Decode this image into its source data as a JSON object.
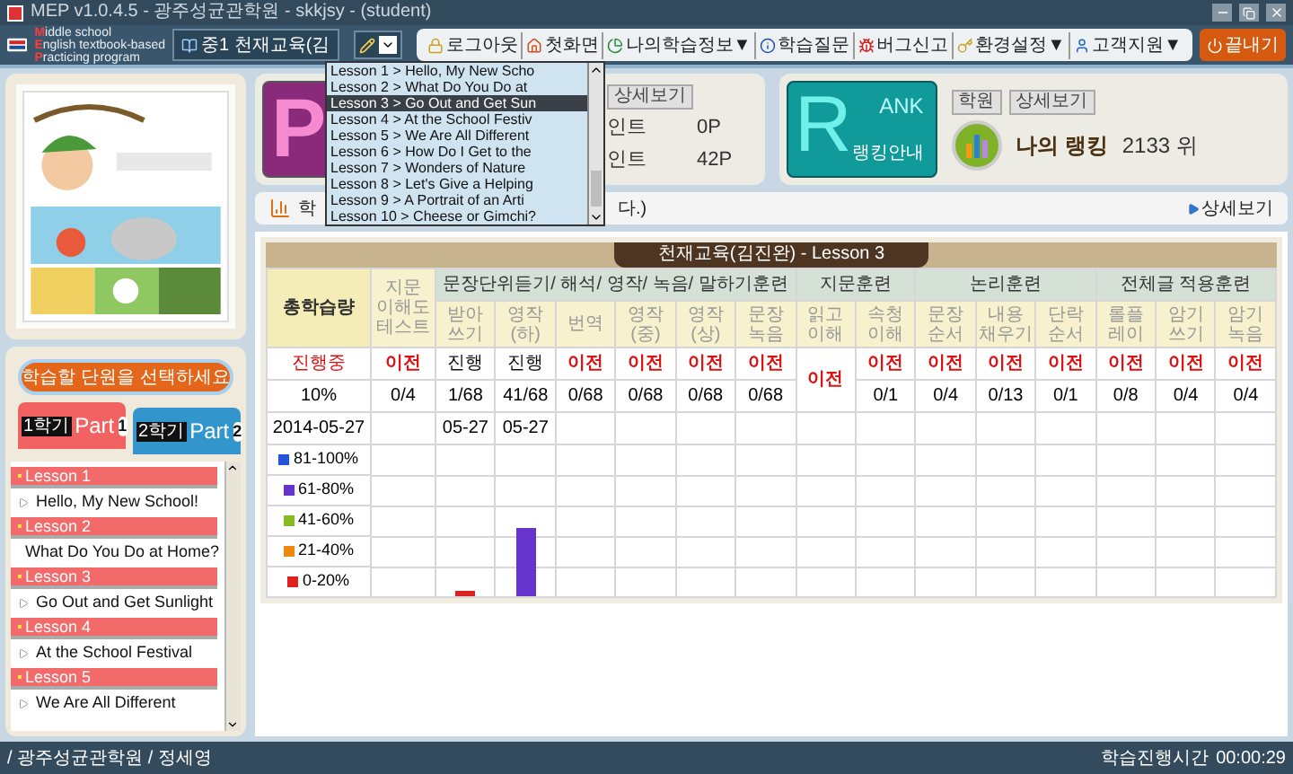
{
  "window": {
    "title": "MEP v1.0.4.5 - 광주성균관학원 - skkjsy - (student)"
  },
  "header": {
    "logo_lines": [
      {
        "initial": "M",
        "rest": "iddle school"
      },
      {
        "initial": "E",
        "rest": "nglish textbook-based"
      },
      {
        "initial": "P",
        "rest": "racticing program"
      }
    ],
    "course_tab": "중1 천재교육(김",
    "toolbar": [
      {
        "label": "로그아웃",
        "kind": "lock"
      },
      {
        "label": "첫화면",
        "kind": "home"
      },
      {
        "label": "나의학습정보▼",
        "kind": "chart"
      },
      {
        "label": "학습질문",
        "kind": "info"
      },
      {
        "label": "버그신고",
        "kind": "bug"
      },
      {
        "label": "환경설정▼",
        "kind": "key"
      },
      {
        "label": "고객지원▼",
        "kind": "person"
      }
    ],
    "exit_button": "끝내기"
  },
  "lesson_dropdown": {
    "expanded": true,
    "options": [
      {
        "label": "Lesson 1 > Hello, My New Scho",
        "selected": false
      },
      {
        "label": "Lesson 2 > What Do You Do at",
        "selected": false
      },
      {
        "label": "Lesson 3 > Go Out and Get Sun",
        "selected": true
      },
      {
        "label": "Lesson 4 > At the School Festiv",
        "selected": false
      },
      {
        "label": "Lesson 5 > We Are All Different",
        "selected": false
      },
      {
        "label": "Lesson 6 > How Do I Get to the",
        "selected": false
      },
      {
        "label": "Lesson 7 > Wonders of Nature",
        "selected": false
      },
      {
        "label": "Lesson 8 > Let's Give a Helping",
        "selected": false
      },
      {
        "label": "Lesson 9 > A Portrait of an Arti",
        "selected": false
      },
      {
        "label": "Lesson 10 > Cheese or Gimchi?",
        "selected": false
      }
    ]
  },
  "point_card": {
    "tile_letter": "P",
    "buttons": [
      "상세보기"
    ],
    "rows": [
      {
        "label": "인트",
        "value": "0P"
      },
      {
        "label": "인트",
        "value": "42P"
      }
    ]
  },
  "rank_card": {
    "tile_letter": "R",
    "tile_word": "ANK",
    "tile_caption": "랭킹안내",
    "buttons": [
      "학원",
      "상세보기"
    ],
    "label": "나의 랭킹",
    "value": "2133 위"
  },
  "study_bar": {
    "prefix": "학",
    "suffix": "다.)",
    "link": "상세보기"
  },
  "sidebar": {
    "select_button": "학습할 단원을 선택하세요",
    "part_tabs": [
      {
        "semester": "1학기",
        "label": "Part",
        "number": "1",
        "selected": true
      },
      {
        "semester": "2학기",
        "label": "Part",
        "number": "2",
        "selected": false
      }
    ],
    "lessons": [
      {
        "label": "Lesson 1",
        "title": "Hello, My New School!"
      },
      {
        "label": "Lesson 2",
        "title": "What Do You Do at Home?"
      },
      {
        "label": "Lesson 3",
        "title": "Go Out and Get Sunlight"
      },
      {
        "label": "Lesson 4",
        "title": "At the School Festival"
      },
      {
        "label": "Lesson 5",
        "title": "We Are All Different"
      }
    ]
  },
  "table": {
    "title": "천재교육(김진완) - Lesson 3",
    "summary": {
      "header": "총학습량",
      "status": "진행중",
      "count": "10%",
      "date": "2014-05-27"
    },
    "legend": [
      {
        "label": "81-100%",
        "color": "#2255dd"
      },
      {
        "label": "61-80%",
        "color": "#6633cc"
      },
      {
        "label": "41-60%",
        "color": "#88bb22"
      },
      {
        "label": "21-40%",
        "color": "#ee8811"
      },
      {
        "label": "0-20%",
        "color": "#dd2222"
      }
    ],
    "test_column": {
      "header": "지문\n이해도\n테스트",
      "status": "이전",
      "emphasized": true,
      "count": "0/4"
    },
    "groups": [
      {
        "title": "문장단위듣기/ 해석/ 영작/ 녹음/ 말하기훈련",
        "columns": [
          {
            "header": "받아\n쓰기",
            "status": "진행",
            "emphasized": false,
            "count": "1/68",
            "date": "05-27",
            "bar": {
              "level": 0.04,
              "color": "#dd2222"
            }
          },
          {
            "header": "영작\n(하)",
            "status": "진행",
            "emphasized": false,
            "count": "41/68",
            "date": "05-27",
            "bar": {
              "level": 0.45,
              "color": "#6633cc"
            }
          },
          {
            "header": "번역",
            "status": "이전",
            "emphasized": true,
            "count": "0/68"
          },
          {
            "header": "영작\n(중)",
            "status": "이전",
            "emphasized": true,
            "count": "0/68"
          },
          {
            "header": "영작\n(상)",
            "status": "이전",
            "emphasized": true,
            "count": "0/68"
          },
          {
            "header": "문장\n녹음",
            "status": "이전",
            "emphasized": true,
            "count": "0/68"
          }
        ]
      },
      {
        "title": "지문훈련",
        "columns": [
          {
            "header": "읽고\n이해",
            "status": "이전",
            "emphasized": true,
            "merged": true
          },
          {
            "header": "속청\n이해",
            "status": "이전",
            "emphasized": true,
            "count": "0/1"
          }
        ]
      },
      {
        "title": "논리훈련",
        "columns": [
          {
            "header": "문장\n순서",
            "status": "이전",
            "emphasized": true,
            "count": "0/4"
          },
          {
            "header": "내용\n채우기",
            "status": "이전",
            "emphasized": true,
            "count": "0/13"
          },
          {
            "header": "단락\n순서",
            "status": "이전",
            "emphasized": true,
            "count": "0/1"
          }
        ]
      },
      {
        "title": "전체글 적용훈련",
        "columns": [
          {
            "header": "롤플\n레이",
            "status": "이전",
            "emphasized": true,
            "count": "0/8"
          },
          {
            "header": "암기\n쓰기",
            "status": "이전",
            "emphasized": true,
            "count": "0/4"
          },
          {
            "header": "암기\n녹음",
            "status": "이전",
            "emphasized": true,
            "count": "0/4"
          }
        ]
      }
    ]
  },
  "status_bar": {
    "path": "/ 광주성균관학원 / 정세영",
    "timer_label": "학습진행시간",
    "timer": "00:00:29"
  }
}
